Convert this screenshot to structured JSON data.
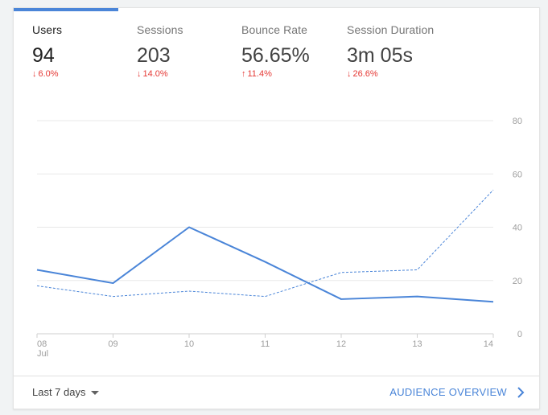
{
  "metrics": [
    {
      "label": "Users",
      "value": "94",
      "change": "6.0%",
      "direction": "down"
    },
    {
      "label": "Sessions",
      "value": "203",
      "change": "14.0%",
      "direction": "down"
    },
    {
      "label": "Bounce Rate",
      "value": "56.65%",
      "change": "11.4%",
      "direction": "up"
    },
    {
      "label": "Session Duration",
      "value": "3m 05s",
      "change": "26.6%",
      "direction": "down"
    }
  ],
  "colors": {
    "accent": "#4a85d8",
    "change_negative": "#e53935"
  },
  "footer": {
    "range_label": "Last 7 days",
    "link_label": "AUDIENCE OVERVIEW",
    "caret_icon": "caret-down-icon",
    "chevron_icon": "chevron-right-icon"
  },
  "chart_data": {
    "type": "line",
    "categories": [
      "08",
      "09",
      "10",
      "11",
      "12",
      "13",
      "14"
    ],
    "category_sublabels": [
      "Jul",
      "",
      "",
      "",
      "",
      "",
      ""
    ],
    "y_ticks": [
      0,
      20,
      40,
      60,
      80
    ],
    "ylim": [
      0,
      80
    ],
    "grid": true,
    "series": [
      {
        "values": [
          24,
          19,
          40,
          27,
          13,
          14,
          12
        ],
        "style": "solid"
      },
      {
        "values": [
          18,
          14,
          16,
          14,
          23,
          24,
          54
        ],
        "style": "dashed"
      }
    ]
  }
}
